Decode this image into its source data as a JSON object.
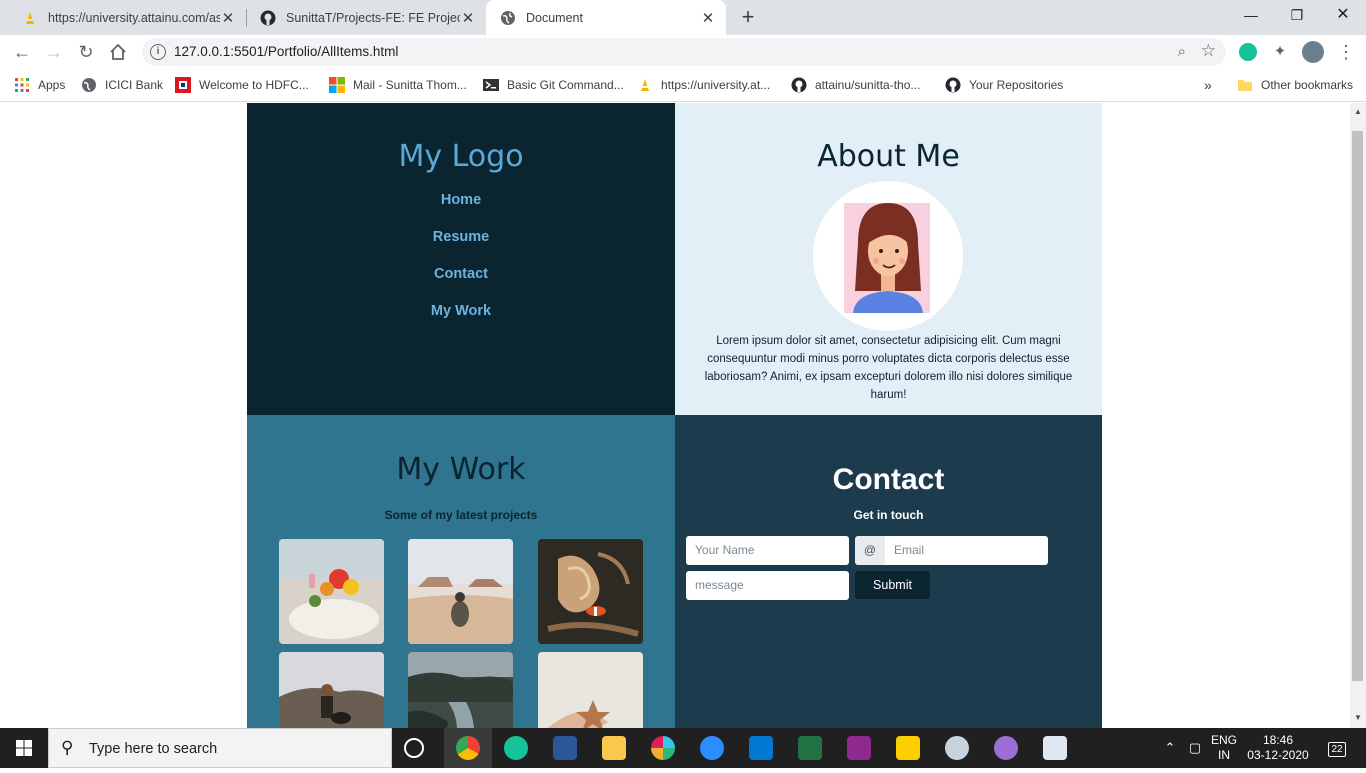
{
  "browser": {
    "tabs": [
      {
        "title": "https://university.attainu.com/ass",
        "active": false
      },
      {
        "title": "SunittaT/Projects-FE: FE Projects",
        "active": false
      },
      {
        "title": "Document",
        "active": true
      }
    ],
    "url": "127.0.0.1:5501/Portfolio/AllItems.html",
    "bookmarks": [
      {
        "label": "Apps",
        "icon": "apps-grid-icon"
      },
      {
        "label": "ICICI Bank",
        "icon": "globe-icon"
      },
      {
        "label": "Welcome to HDFC...",
        "icon": "hdfc-icon"
      },
      {
        "label": "Mail - Sunitta Thom...",
        "icon": "microsoft-icon"
      },
      {
        "label": "Basic Git Command...",
        "icon": "git-icon"
      },
      {
        "label": "https://university.at...",
        "icon": "attainu-icon"
      },
      {
        "label": "attainu/sunitta-tho...",
        "icon": "github-icon"
      },
      {
        "label": "Your Repositories",
        "icon": "github-icon"
      }
    ],
    "overflow_label": "»",
    "other_bookmarks": "Other bookmarks"
  },
  "page": {
    "nav": {
      "logo": "My Logo",
      "links": [
        "Home",
        "Resume",
        "Contact",
        "My Work"
      ]
    },
    "about": {
      "title": "About Me",
      "text": "Lorem ipsum dolor sit amet, consectetur adipisicing elit. Cum magni consequuntur modi minus porro voluptates dicta corporis delectus esse laboriosam? Animi, ex ipsam excepturi dolorem illo nisi dolores similique harum!"
    },
    "work": {
      "title": "My Work",
      "subtitle": "Some of my latest projects"
    },
    "contact": {
      "title": "Contact",
      "subtitle": "Get in touch",
      "name_placeholder": "Your Name",
      "email_prefix": "@",
      "email_placeholder": "Email",
      "message_placeholder": "message",
      "submit_label": "Submit"
    }
  },
  "taskbar": {
    "search_placeholder": "Type here to search",
    "language": "ENG",
    "region": "IN",
    "time": "18:46",
    "date": "03-12-2020",
    "notification_count": "22"
  },
  "colors": {
    "nav_bg": "#0a2430",
    "about_bg": "#e3eff6",
    "work_bg": "#30758f",
    "contact_bg": "#1c3c4e",
    "accent": "#5aa9d6"
  }
}
